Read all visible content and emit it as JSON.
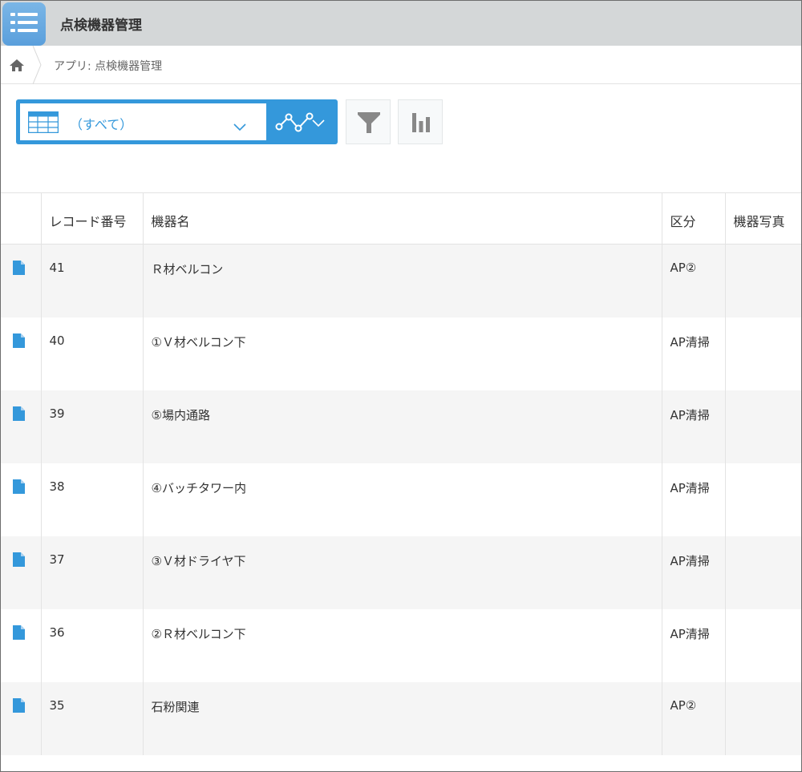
{
  "header": {
    "title": "点検機器管理",
    "icon": "list-app-icon",
    "color": "#d4d7d8"
  },
  "breadcrumb": {
    "home_icon": "home-icon",
    "path": "アプリ: 点検機器管理"
  },
  "toolbar": {
    "view_label": "（すべて）",
    "accent": "#3498db",
    "icons": [
      "table-view-icon",
      "chevron-down-icon",
      "graph-icon",
      "filter-icon",
      "bar-chart-icon"
    ]
  },
  "table": {
    "columns": [
      "",
      "レコード番号",
      "機器名",
      "区分",
      "機器写真"
    ],
    "rows": [
      {
        "id": "41",
        "name": "Ｒ材ベルコン",
        "category": "AP②",
        "photo": ""
      },
      {
        "id": "40",
        "name": "①Ｖ材ベルコン下",
        "category": "AP清掃",
        "photo": ""
      },
      {
        "id": "39",
        "name": "⑤場内通路",
        "category": "AP清掃",
        "photo": ""
      },
      {
        "id": "38",
        "name": "④バッチタワー内",
        "category": "AP清掃",
        "photo": ""
      },
      {
        "id": "37",
        "name": "③Ｖ材ドライヤ下",
        "category": "AP清掃",
        "photo": ""
      },
      {
        "id": "36",
        "name": "②Ｒ材ベルコン下",
        "category": "AP清掃",
        "photo": ""
      },
      {
        "id": "35",
        "name": "石粉関連",
        "category": "AP②",
        "photo": ""
      }
    ]
  }
}
